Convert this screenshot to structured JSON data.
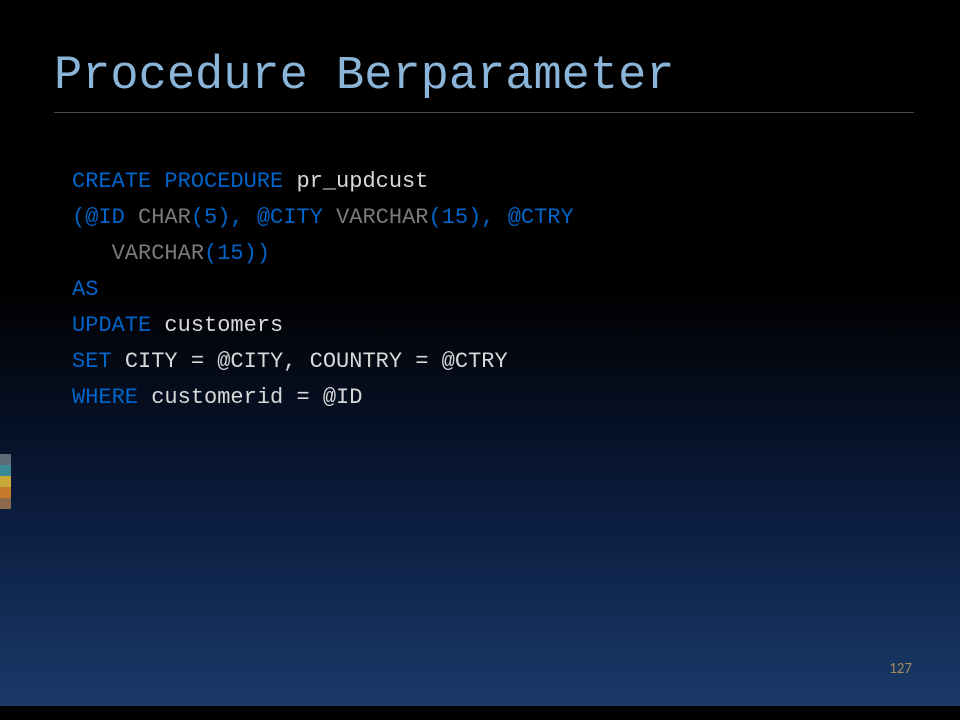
{
  "title": "Procedure Berparameter",
  "code": {
    "l1": {
      "kw": "CREATE PROCEDURE ",
      "id": "pr_updcust"
    },
    "l2a": "(@ID ",
    "l2b": "CHAR",
    "l2c": "(5), @CITY ",
    "l2d": "VARCHAR",
    "l2e": "(15), @CTRY ",
    "l3a": "   ",
    "l3b": "VARCHAR",
    "l3c": "(15))",
    "l4": "AS",
    "l5a": "UPDATE ",
    "l5b": "customers",
    "l6a": "SET ",
    "l6b": "CITY = @CITY, COUNTRY = @CTRY",
    "l7a": "WHERE ",
    "l7b": "customerid = @ID"
  },
  "page_number": "127",
  "accent_colors": [
    "#5d6a78",
    "#3a8a95",
    "#c9a93a",
    "#c47a2a",
    "#8a6a4a"
  ]
}
